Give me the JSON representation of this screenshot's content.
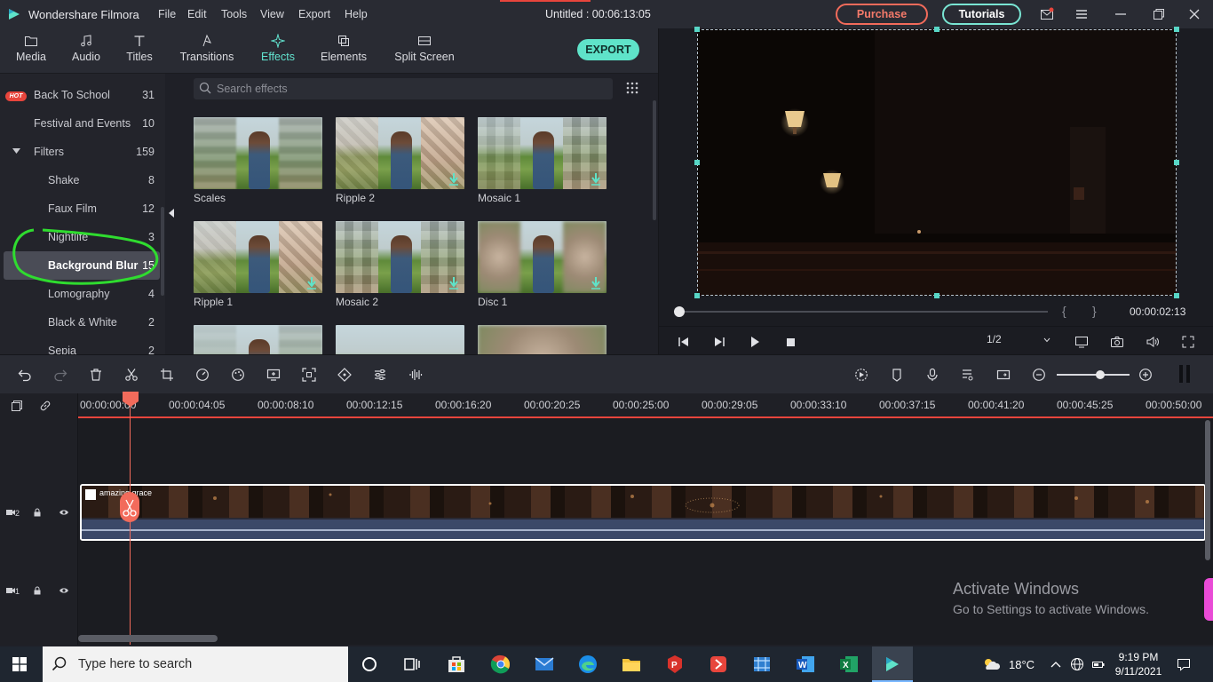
{
  "app": {
    "name": "Wondershare Filmora",
    "document_title": "Untitled : 00:06:13:05",
    "menu": [
      "File",
      "Edit",
      "Tools",
      "View",
      "Export",
      "Help"
    ],
    "purchase_label": "Purchase",
    "tutorials_label": "Tutorials"
  },
  "library": {
    "tabs": [
      {
        "label": "Media",
        "icon": "folder-icon"
      },
      {
        "label": "Audio",
        "icon": "music-note-icon"
      },
      {
        "label": "Titles",
        "icon": "text-t-icon"
      },
      {
        "label": "Transitions",
        "icon": "transition-icon"
      },
      {
        "label": "Effects",
        "icon": "sparkle-icon",
        "active": true
      },
      {
        "label": "Elements",
        "icon": "elements-icon"
      },
      {
        "label": "Split Screen",
        "icon": "split-screen-icon"
      }
    ],
    "export_label": "EXPORT",
    "hot_badge": "HOT",
    "categories": [
      {
        "label": "Back To School",
        "count": "31",
        "badge": "HOT"
      },
      {
        "label": "Festival and Events",
        "count": "10"
      },
      {
        "label": "Filters",
        "count": "159",
        "expanded": true
      },
      {
        "label": "Shake",
        "count": "8"
      },
      {
        "label": "Faux Film",
        "count": "12"
      },
      {
        "label": "Nightlife",
        "count": "3"
      },
      {
        "label": "Background Blur",
        "count": "15",
        "selected": true
      },
      {
        "label": "Lomography",
        "count": "4"
      },
      {
        "label": "Black & White",
        "count": "2"
      },
      {
        "label": "Sepia",
        "count": "2"
      }
    ],
    "search_placeholder": "Search effects",
    "effects": [
      {
        "name": "Scales",
        "downloaded": true
      },
      {
        "name": "Ripple 2",
        "downloaded": false
      },
      {
        "name": "Mosaic 1",
        "downloaded": false
      },
      {
        "name": "Ripple 1",
        "downloaded": false
      },
      {
        "name": "Mosaic 2",
        "downloaded": false
      },
      {
        "name": "Disc 1",
        "downloaded": false
      }
    ]
  },
  "preview": {
    "timecode": "00:00:02:13",
    "brace_open": "{",
    "brace_close": "}",
    "ratio": "1/2",
    "playback_progress": 0.0
  },
  "timeline": {
    "ruler": [
      "00:00:00:00",
      "00:00:04:05",
      "00:00:08:10",
      "00:00:12:15",
      "00:00:16:20",
      "00:00:20:25",
      "00:00:25:00",
      "00:00:29:05",
      "00:00:33:10",
      "00:00:37:15",
      "00:00:41:20",
      "00:00:45:25",
      "00:00:50:00"
    ],
    "clip_name": "amazing grace",
    "tracks": [
      {
        "label": "2"
      },
      {
        "label": "1"
      }
    ],
    "zoom_level": 0.55
  },
  "watermark": {
    "title": "Activate Windows",
    "subtitle": "Go to Settings to activate Windows."
  },
  "taskbar": {
    "search_placeholder": "Type here to search",
    "weather": "18°C",
    "time": "9:19 PM",
    "date": "9/11/2021"
  },
  "colors": {
    "accent": "#5fe3c9",
    "purchase": "#f26b5b",
    "playhead": "#f26b5b",
    "panel": "#23242b"
  }
}
